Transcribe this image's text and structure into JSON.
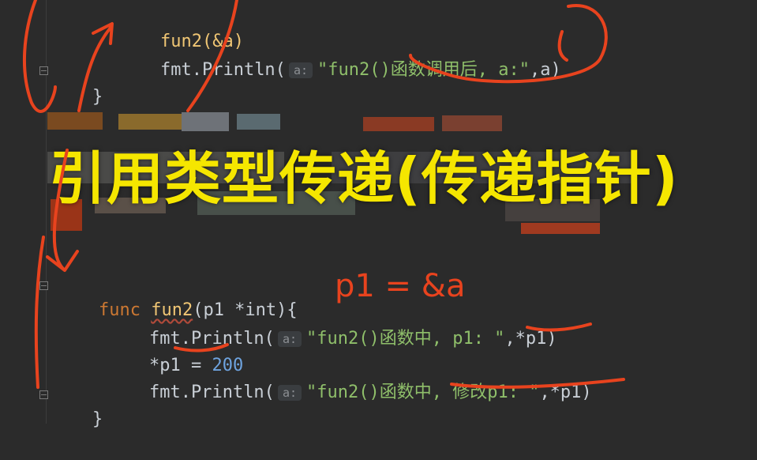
{
  "headline": "引用类型传递(传递指针)",
  "annotation": "p1 = &a",
  "param_hint": "a:",
  "colors": {
    "background": "#2b2b2b",
    "headline": "#f5e600",
    "ink": "#e8431e",
    "keyword": "#cc7832",
    "function": "#f0c674",
    "string": "#8fbf6a",
    "number": "#6ea3df"
  },
  "code": {
    "line1": {
      "call": "fun2(&a)"
    },
    "line2": {
      "prefix": "fmt.Println(",
      "string": "\"fun2()函数调用后, a:\"",
      "suffix": ",a)"
    },
    "line3": {
      "brace": "}"
    },
    "line4": {
      "keyword": "func",
      "name": "fun2",
      "params": "(p1 *int){"
    },
    "line5": {
      "prefix": "fmt.Println(",
      "string": "\"fun2()函数中, p1: \"",
      "suffix": ",*p1)"
    },
    "line6": {
      "lhs": "*p1 = ",
      "value": "200"
    },
    "line7": {
      "prefix": "fmt.Println(",
      "string": "\"fun2()函数中, 修改p1: \"",
      "suffix": ",*p1)"
    },
    "line8": {
      "brace": "}"
    }
  }
}
